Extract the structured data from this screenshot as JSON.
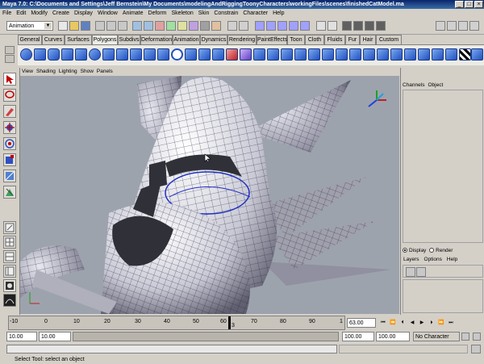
{
  "window": {
    "title": "Maya 7.0: C:\\Documents and Settings\\Jeff Bernstein\\My Documents\\modelingAndRiggingToonyCharacters\\workingFiles\\scenes\\finishedCatModel.ma"
  },
  "menubar": {
    "items": [
      "File",
      "Edit",
      "Modify",
      "Create",
      "Display",
      "Window",
      "Animate",
      "Deform",
      "Skeleton",
      "Skin",
      "Constrain",
      "Character",
      "Help"
    ]
  },
  "statusline": {
    "menu_set": "Animation"
  },
  "shelf": {
    "tabs": [
      "General",
      "Curves",
      "Surfaces",
      "Polygons",
      "Subdivs",
      "Deformation",
      "Animation",
      "Dynamics",
      "Rendering",
      "PaintEffects",
      "Toon",
      "Cloth",
      "Fluids",
      "Fur",
      "Hair",
      "Custom"
    ],
    "active_tab": "Polygons"
  },
  "viewport": {
    "panel_menu": [
      "View",
      "Shading",
      "Lighting",
      "Show",
      "Panels"
    ]
  },
  "channel_box": {
    "menu": [
      "Channels",
      "Object"
    ]
  },
  "layer_editor": {
    "display_label": "Display",
    "render_label": "Render",
    "menu": [
      "Layers",
      "Options",
      "Help"
    ]
  },
  "time_slider": {
    "ticks": [
      "-10",
      "0",
      "10",
      "20",
      "30",
      "40",
      "50",
      "60",
      "70",
      "80",
      "90",
      "1"
    ],
    "current_frame": "63.00",
    "ghost": "3"
  },
  "range_slider": {
    "start_time": "10.00",
    "playback_start": "10.00",
    "playback_end": "100.00",
    "end_time": "100.00",
    "character_set": "No Character Set"
  },
  "help_line": {
    "text": "Select Tool: select an object"
  },
  "colors": {
    "ui_gray": "#d4d0c8",
    "viewport_bg": "#9da3ad",
    "selection_blue": "#2030c0",
    "title_blue": "#0a246a"
  }
}
